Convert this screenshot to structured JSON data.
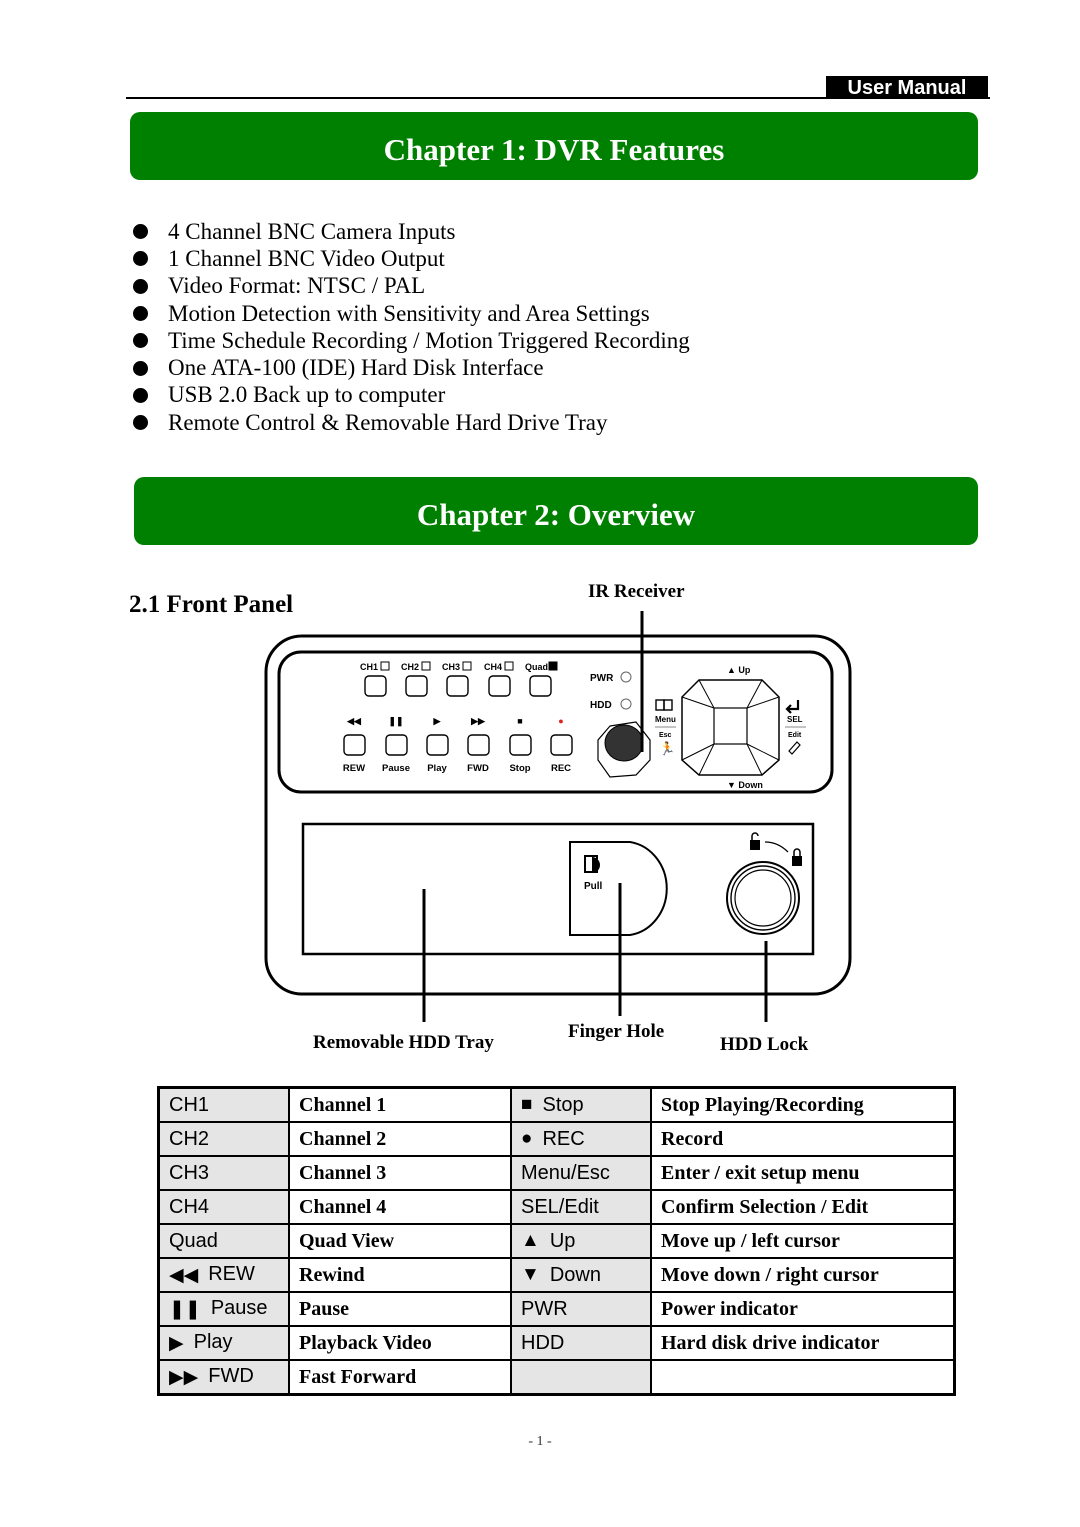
{
  "header": {
    "tag": "User Manual"
  },
  "chapter1": {
    "title": "Chapter 1: DVR Features",
    "features": [
      "4 Channel BNC Camera Inputs",
      "1 Channel BNC Video Output",
      "Video Format: NTSC / PAL",
      "Motion Detection with Sensitivity and Area Settings",
      "Time Schedule Recording / Motion Triggered Recording",
      "One ATA-100 (IDE) Hard Disk Interface",
      "USB 2.0 Back up to computer",
      "Remote Control & Removable Hard Drive Tray"
    ]
  },
  "chapter2": {
    "title": "Chapter 2: Overview",
    "section_title": "2.1 Front Panel",
    "diagram": {
      "callouts": {
        "ir_receiver": "IR Receiver",
        "removable_tray": "Removable HDD Tray",
        "finger_hole": "Finger Hole",
        "hdd_lock": "HDD Lock"
      },
      "channel_buttons": [
        "CH1",
        "CH2",
        "CH3",
        "CH4",
        "Quad"
      ],
      "transport_buttons": [
        "REW",
        "Pause",
        "Play",
        "FWD",
        "Stop",
        "REC"
      ],
      "indicators": [
        "PWR",
        "HDD"
      ],
      "nav_labels": {
        "up": "Up",
        "down": "Down",
        "menu": "Menu",
        "esc": "Esc",
        "sel": "SEL",
        "edit": "Edit"
      },
      "tray_label": "Pull",
      "accent_rec": "#e0201e"
    },
    "key_table": {
      "rows": [
        {
          "key1": "CH1",
          "desc1": "Channel 1",
          "icon2": "stop-icon",
          "glyph2": "■",
          "key2": "Stop",
          "desc2": "Stop Playing/Recording"
        },
        {
          "key1": "CH2",
          "desc1": "Channel 2",
          "icon2": "record-icon",
          "glyph2": "●",
          "key2": "REC",
          "desc2": "Record"
        },
        {
          "key1": "CH3",
          "desc1": "Channel 3",
          "icon2": "",
          "glyph2": "",
          "key2": "Menu/Esc",
          "desc2": "Enter / exit setup menu"
        },
        {
          "key1": "CH4",
          "desc1": "Channel 4",
          "icon2": "",
          "glyph2": "",
          "key2": "SEL/Edit",
          "desc2": "Confirm Selection / Edit"
        },
        {
          "key1": "Quad",
          "desc1": "Quad View",
          "icon2": "up-arrow-icon",
          "glyph2": "▲",
          "key2": "Up",
          "desc2": "Move up / left cursor"
        },
        {
          "icon1": "rewind-icon",
          "glyph1": "◀◀",
          "key1": "REW",
          "desc1": "Rewind",
          "icon2": "down-arrow-icon",
          "glyph2": "▼",
          "key2": "Down",
          "desc2": "Move down / right cursor"
        },
        {
          "icon1": "pause-icon",
          "glyph1": "❚❚",
          "key1": "Pause",
          "desc1": "Pause",
          "key2": "PWR",
          "desc2": "Power indicator"
        },
        {
          "icon1": "play-icon",
          "glyph1": "▶",
          "key1": "Play",
          "desc1": "Playback Video",
          "key2": "HDD",
          "desc2": "Hard disk drive indicator"
        },
        {
          "icon1": "fast-forward-icon",
          "glyph1": "▶▶",
          "key1": "FWD",
          "desc1": "Fast Forward",
          "key2": "",
          "desc2": ""
        }
      ]
    }
  },
  "footer": {
    "page_number": "- 1 -"
  },
  "colors": {
    "chapter_banner": "#008000"
  }
}
